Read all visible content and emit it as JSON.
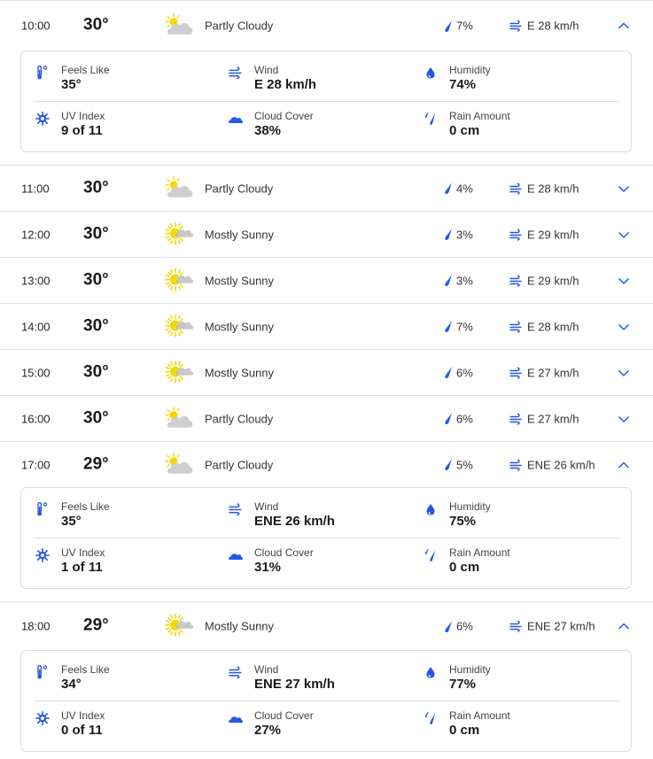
{
  "colors": {
    "accent": "#2458e6",
    "sun": "#f5d800",
    "cloud": "#cfcfcf",
    "divider": "#e1e1e1"
  },
  "detail_labels": {
    "feels_like": "Feels Like",
    "wind": "Wind",
    "humidity": "Humidity",
    "uv_index": "UV Index",
    "cloud_cover": "Cloud Cover",
    "rain_amount": "Rain Amount"
  },
  "hours": [
    {
      "time": "10:00",
      "temp": "30°",
      "condition": "Partly Cloudy",
      "icon": "partly-cloudy-icon",
      "precip": "7%",
      "wind": "E 28 km/h",
      "expanded": true,
      "details": {
        "feels_like": "35°",
        "wind": "E 28 km/h",
        "humidity": "74%",
        "uv_index": "9 of 11",
        "cloud_cover": "38%",
        "rain_amount": "0 cm"
      }
    },
    {
      "time": "11:00",
      "temp": "30°",
      "condition": "Partly Cloudy",
      "icon": "partly-cloudy-icon",
      "precip": "4%",
      "wind": "E 28 km/h",
      "expanded": false
    },
    {
      "time": "12:00",
      "temp": "30°",
      "condition": "Mostly Sunny",
      "icon": "mostly-sunny-icon",
      "precip": "3%",
      "wind": "E 29 km/h",
      "expanded": false
    },
    {
      "time": "13:00",
      "temp": "30°",
      "condition": "Mostly Sunny",
      "icon": "mostly-sunny-icon",
      "precip": "3%",
      "wind": "E 29 km/h",
      "expanded": false
    },
    {
      "time": "14:00",
      "temp": "30°",
      "condition": "Mostly Sunny",
      "icon": "mostly-sunny-icon",
      "precip": "7%",
      "wind": "E 28 km/h",
      "expanded": false
    },
    {
      "time": "15:00",
      "temp": "30°",
      "condition": "Mostly Sunny",
      "icon": "mostly-sunny-icon",
      "precip": "6%",
      "wind": "E 27 km/h",
      "expanded": false
    },
    {
      "time": "16:00",
      "temp": "30°",
      "condition": "Partly Cloudy",
      "icon": "partly-cloudy-icon",
      "precip": "6%",
      "wind": "E 27 km/h",
      "expanded": false
    },
    {
      "time": "17:00",
      "temp": "29°",
      "condition": "Partly Cloudy",
      "icon": "partly-cloudy-icon",
      "precip": "5%",
      "wind": "ENE 26 km/h",
      "expanded": true,
      "details": {
        "feels_like": "35°",
        "wind": "ENE 26 km/h",
        "humidity": "75%",
        "uv_index": "1 of 11",
        "cloud_cover": "31%",
        "rain_amount": "0 cm"
      }
    },
    {
      "time": "18:00",
      "temp": "29°",
      "condition": "Mostly Sunny",
      "icon": "mostly-sunny-icon",
      "precip": "6%",
      "wind": "ENE 27 km/h",
      "expanded": true,
      "details": {
        "feels_like": "34°",
        "wind": "ENE 27 km/h",
        "humidity": "77%",
        "uv_index": "0 of 11",
        "cloud_cover": "27%",
        "rain_amount": "0 cm"
      }
    }
  ]
}
